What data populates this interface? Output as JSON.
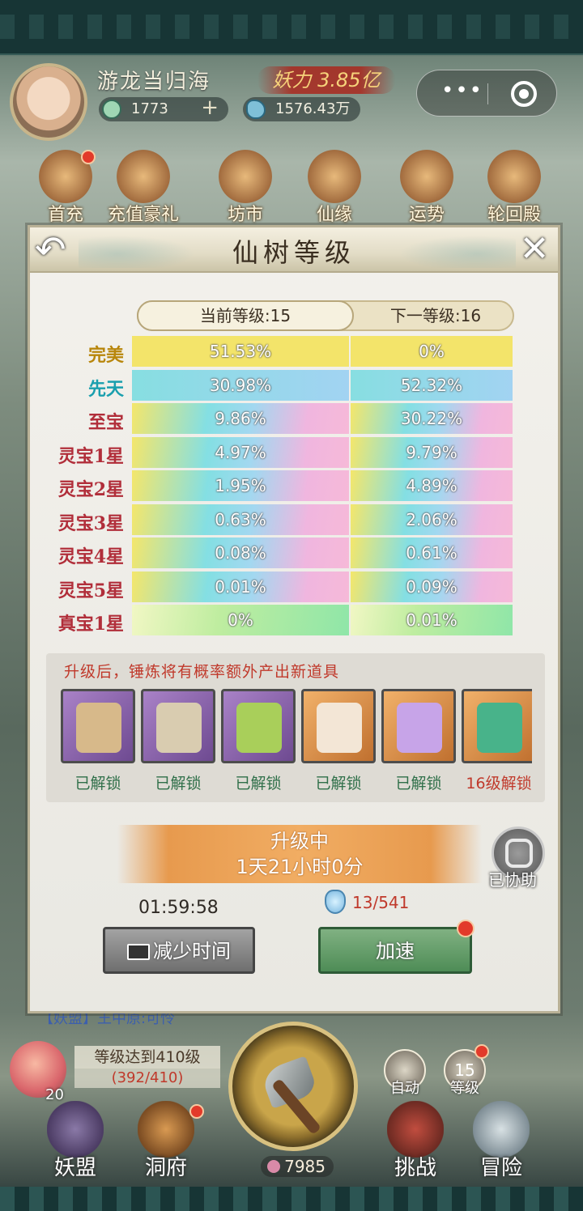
{
  "header": {
    "player_name": "游龙当归海",
    "power_label": "妖力 3.85亿",
    "jade_count": "1773",
    "plus_sign": "+",
    "crystal_count": "1576.43万",
    "capsule_more": "•••"
  },
  "top_menu": [
    {
      "label": "首充"
    },
    {
      "label": "充值豪礼"
    },
    {
      "label": "坊市"
    },
    {
      "label": "仙缘"
    },
    {
      "label": "运势"
    },
    {
      "label": "轮回殿"
    }
  ],
  "dialog": {
    "title": "仙树等级",
    "back_glyph": "↶",
    "close_glyph": "✕",
    "current_level": "当前等级:15",
    "next_level": "下一等级:16",
    "rows": [
      {
        "label": "完美",
        "label_color": "#b8860b",
        "current": "51.53%",
        "next": "0%",
        "style": "yellow"
      },
      {
        "label": "先天",
        "label_color": "#1a9fae",
        "current": "30.98%",
        "next": "52.32%",
        "style": "cyan"
      },
      {
        "label": "至宝",
        "label_color": "#b12e3a",
        "current": "9.86%",
        "next": "30.22%",
        "style": "rainbow"
      },
      {
        "label": "灵宝1星",
        "label_color": "#b12e3a",
        "current": "4.97%",
        "next": "9.79%",
        "style": "rainbow"
      },
      {
        "label": "灵宝2星",
        "label_color": "#b12e3a",
        "current": "1.95%",
        "next": "4.89%",
        "style": "rainbow"
      },
      {
        "label": "灵宝3星",
        "label_color": "#b12e3a",
        "current": "0.63%",
        "next": "2.06%",
        "style": "rainbow"
      },
      {
        "label": "灵宝4星",
        "label_color": "#b12e3a",
        "current": "0.08%",
        "next": "0.61%",
        "style": "rainbow"
      },
      {
        "label": "灵宝5星",
        "label_color": "#b12e3a",
        "current": "0.01%",
        "next": "0.09%",
        "style": "rainbow"
      },
      {
        "label": "真宝1星",
        "label_color": "#b12e3a",
        "current": "0%",
        "next": "0.01%",
        "style": "green"
      }
    ],
    "upgrade_hint": "升级后，锤炼将有概率额外产出新道具",
    "items": [
      {
        "status": "已解锁",
        "bg": "purple",
        "art": "scroll-icon",
        "art_color": "#d7b98a",
        "locked": false
      },
      {
        "status": "已解锁",
        "bg": "purple",
        "art": "books-icon",
        "art_color": "#d9ccb0",
        "locked": false
      },
      {
        "status": "已解锁",
        "bg": "purple",
        "art": "fruit-icon",
        "art_color": "#a9cf5a",
        "locked": false
      },
      {
        "status": "已解锁",
        "bg": "orange",
        "art": "talisman-icon",
        "art_color": "#f3e6d6",
        "locked": false
      },
      {
        "status": "已解锁",
        "bg": "orange",
        "art": "flower-icon",
        "art_color": "#c7a4e8",
        "locked": false
      },
      {
        "status": "16级解锁",
        "bg": "orange",
        "art": "jade-dragon-icon",
        "art_color": "#48b38a",
        "locked": true
      }
    ],
    "upgrading_title": "升级中",
    "upgrading_time": "1天21小时0分",
    "assist_label": "已协助",
    "countdown": "01:59:58",
    "speedup_cost": "13/541",
    "reduce_time_button": "减少时间",
    "speedup_button": "加速"
  },
  "bottom": {
    "chat_text": "【妖盟】王中原:可怜",
    "level_goal": "等级达到410级",
    "level_progress": "(392/410)",
    "level_badge": "20",
    "auto_label": "自动",
    "level_button_number": "15",
    "level_button_label": "等级",
    "axe_count": "7985",
    "nav": [
      {
        "label": "妖盟"
      },
      {
        "label": "洞府"
      },
      {
        "label": "挑战"
      },
      {
        "label": "冒险"
      }
    ]
  }
}
